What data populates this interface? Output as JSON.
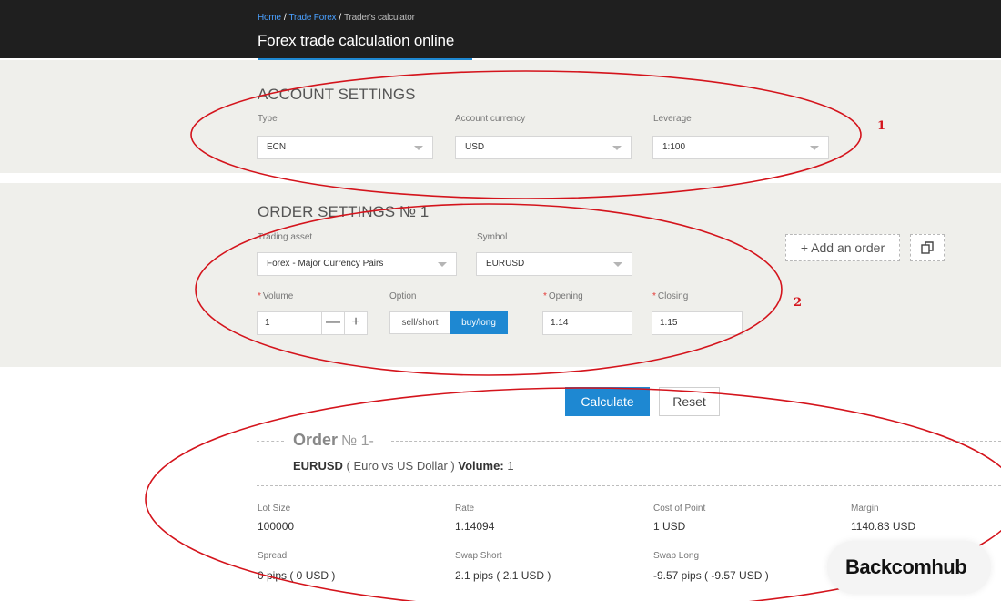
{
  "header": {
    "breadcrumb": [
      "Home",
      "Trade Forex",
      "Trader's calculator"
    ],
    "breadcrumb_sep": "/",
    "title": "Forex trade calculation online"
  },
  "account_settings": {
    "title": "ACCOUNT SETTINGS",
    "type": {
      "label": "Type",
      "value": "ECN"
    },
    "currency": {
      "label": "Account currency",
      "value": "USD"
    },
    "leverage": {
      "label": "Leverage",
      "value": "1:100"
    }
  },
  "order_settings": {
    "title": "ORDER SETTINGS № 1",
    "trading_asset": {
      "label": "Trading asset",
      "value": "Forex - Major Currency Pairs"
    },
    "symbol": {
      "label": "Symbol",
      "value": "EURUSD"
    },
    "volume": {
      "label": "Volume",
      "value": "1",
      "minus": "—",
      "plus": "+"
    },
    "option": {
      "label": "Option",
      "sell": "sell/short",
      "buy": "buy/long",
      "selected": "buy/long"
    },
    "opening": {
      "label": "Opening",
      "value": "1.14"
    },
    "closing": {
      "label": "Closing",
      "value": "1.15"
    },
    "required_mark": "*",
    "add_order": "+ Add an order",
    "copy_icon": "copy-icon"
  },
  "actions": {
    "calculate": "Calculate",
    "reset": "Reset"
  },
  "result": {
    "heading_label": "Order",
    "heading_num": "№ 1-",
    "symbol": "EURUSD",
    "symbol_desc": "( Euro vs US Dollar )",
    "volume_label": "Volume:",
    "volume_value": "1",
    "row1": [
      {
        "label": "Lot Size",
        "value": "100000"
      },
      {
        "label": "Rate",
        "value": "1.14094"
      },
      {
        "label": "Cost of Point",
        "value": "1 USD"
      },
      {
        "label": "Margin",
        "value": "1140.83 USD"
      }
    ],
    "row2": [
      {
        "label": "Spread",
        "value": "0 pips ( 0 USD )"
      },
      {
        "label": "Swap Short",
        "value": "2.1 pips ( 2.1 USD )"
      },
      {
        "label": "Swap Long",
        "value": "-9.57 pips ( -9.57 USD )"
      }
    ]
  },
  "annotations": {
    "one": "1",
    "two": "2",
    "color": "#d4141c"
  },
  "watermark": {
    "text": "Backcomhub"
  },
  "colors": {
    "accent": "#1e88d2",
    "header_bg": "#1f1f1f",
    "section_bg": "#efefeb"
  }
}
